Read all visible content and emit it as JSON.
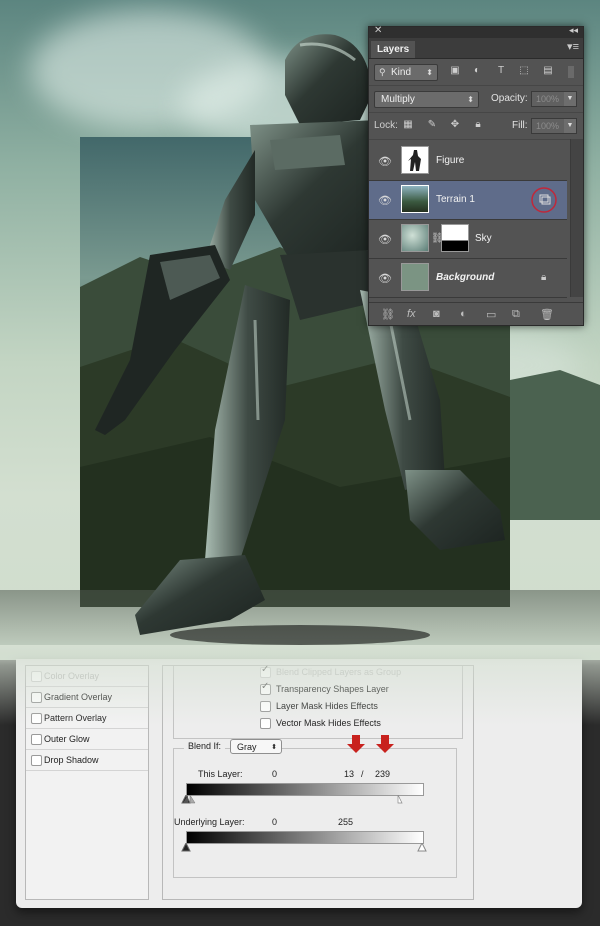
{
  "layers_panel": {
    "tab_label": "Layers",
    "filter_kind": "Kind",
    "blend_mode": "Multiply",
    "opacity_label": "Opacity:",
    "opacity_value": "100%",
    "lock_label": "Lock:",
    "fill_label": "Fill:",
    "fill_value": "100%",
    "layers": [
      {
        "name": "Figure",
        "selected": false
      },
      {
        "name": "Terrain 1",
        "selected": true
      },
      {
        "name": "Sky",
        "selected": false
      },
      {
        "name": "Background",
        "selected": false
      }
    ],
    "highlight_color": "#c0283a",
    "selection_color": "#5f6c8a"
  },
  "dialog": {
    "styles": [
      "Color Overlay",
      "Gradient Overlay",
      "Pattern Overlay",
      "Outer Glow",
      "Drop Shadow"
    ],
    "options": {
      "clipped": "Blend Clipped Layers as Group",
      "transparency": "Transparency Shapes Layer",
      "layer_mask": "Layer Mask Hides Effects",
      "vector_mask": "Vector Mask Hides Effects"
    },
    "blend_if_label": "Blend If:",
    "blend_if_value": "Gray",
    "this_layer_label": "This Layer:",
    "this_layer_black": "0",
    "this_layer_white_low": "13",
    "slash": "/",
    "this_layer_white_high": "239",
    "underlying_label": "Underlying Layer:",
    "underlying_black": "0",
    "underlying_white": "255",
    "arrow_color": "#c8221e"
  }
}
